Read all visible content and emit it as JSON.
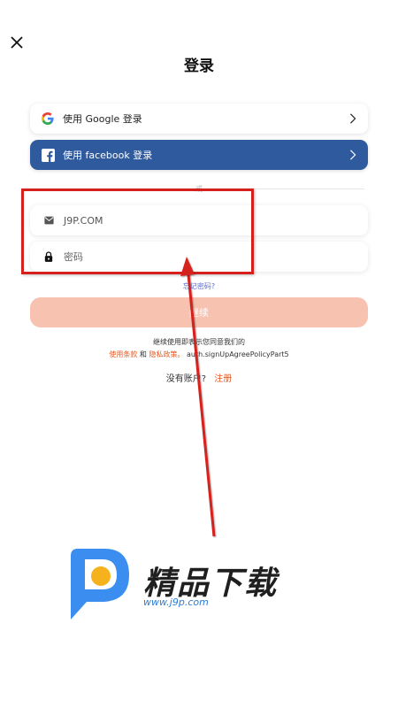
{
  "title": "登录",
  "oauth": {
    "google_label": "使用 Google 登录",
    "facebook_label": "使用 facebook 登录"
  },
  "divider": {
    "text": "或"
  },
  "form": {
    "email_value": "J9P.COM",
    "password_placeholder": "密码"
  },
  "forgot_password": "忘记密码?",
  "continue_label": "继续",
  "agreement": {
    "line1": "继续使用即表示您同意我们的",
    "terms": "使用条款",
    "and": "和",
    "privacy": "隐私政策。",
    "policy_key": "auth.signUpAgreePolicyPart5"
  },
  "signup": {
    "prompt": "没有账户?",
    "link": "注册"
  },
  "watermark": {
    "title": "精品下载",
    "url": "www.j9p.com"
  },
  "colors": {
    "facebook": "#2f5a9d",
    "continue": "#f8c2b0",
    "link_orange": "#e35a24",
    "link_blue": "#5c6bd1",
    "annotation_red": "#d6201c"
  },
  "icons": {
    "close": "close-icon",
    "google": "google-icon",
    "facebook": "facebook-icon",
    "chevron": "chevron-right-icon",
    "mail": "mail-icon",
    "lock": "lock-icon"
  }
}
